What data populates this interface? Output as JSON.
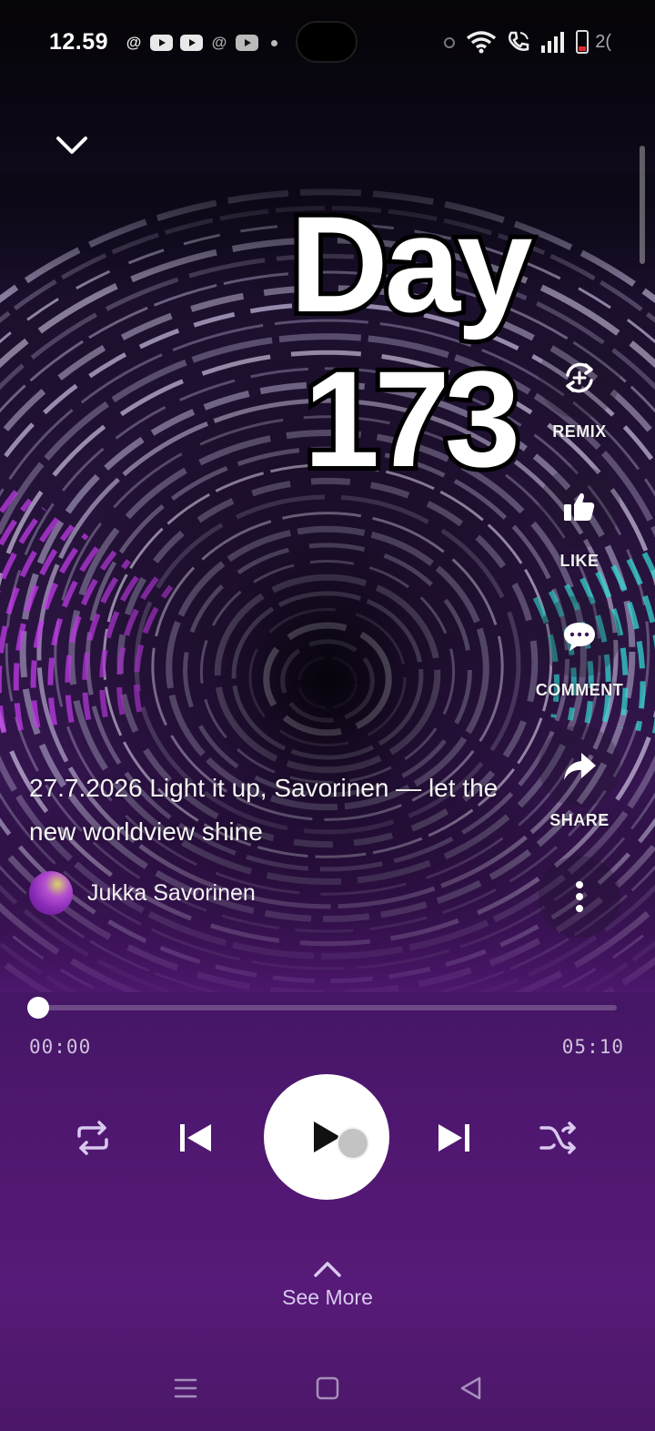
{
  "status_bar": {
    "time": "12.59",
    "notification_icons": [
      "threads-icon",
      "youtube-icon",
      "youtube-icon",
      "threads-icon",
      "youtube-icon"
    ],
    "system_icons": [
      "alarm-icon",
      "wifi-icon",
      "wifi-call-icon",
      "signal-icon",
      "battery-icon"
    ],
    "battery_text": "2("
  },
  "overlay": {
    "word": "Day",
    "number": "173"
  },
  "actions": {
    "remix_label": "REMIX",
    "like_label": "LIKE",
    "comment_label": "COMMENT",
    "share_label": "SHARE"
  },
  "track": {
    "caption": "27.7.2026 Light it up, Savorinen — let the new worldview shine",
    "artist": "Jukka Savorinen"
  },
  "player": {
    "current_time": "00:00",
    "total_time": "05:10",
    "progress": 0
  },
  "see_more_label": "See More",
  "colors": {
    "accent_purple": "#571a78",
    "ring_magenta": "#c03be8",
    "ring_cyan": "#34d6d0",
    "battery_low": "#e12b2b"
  }
}
